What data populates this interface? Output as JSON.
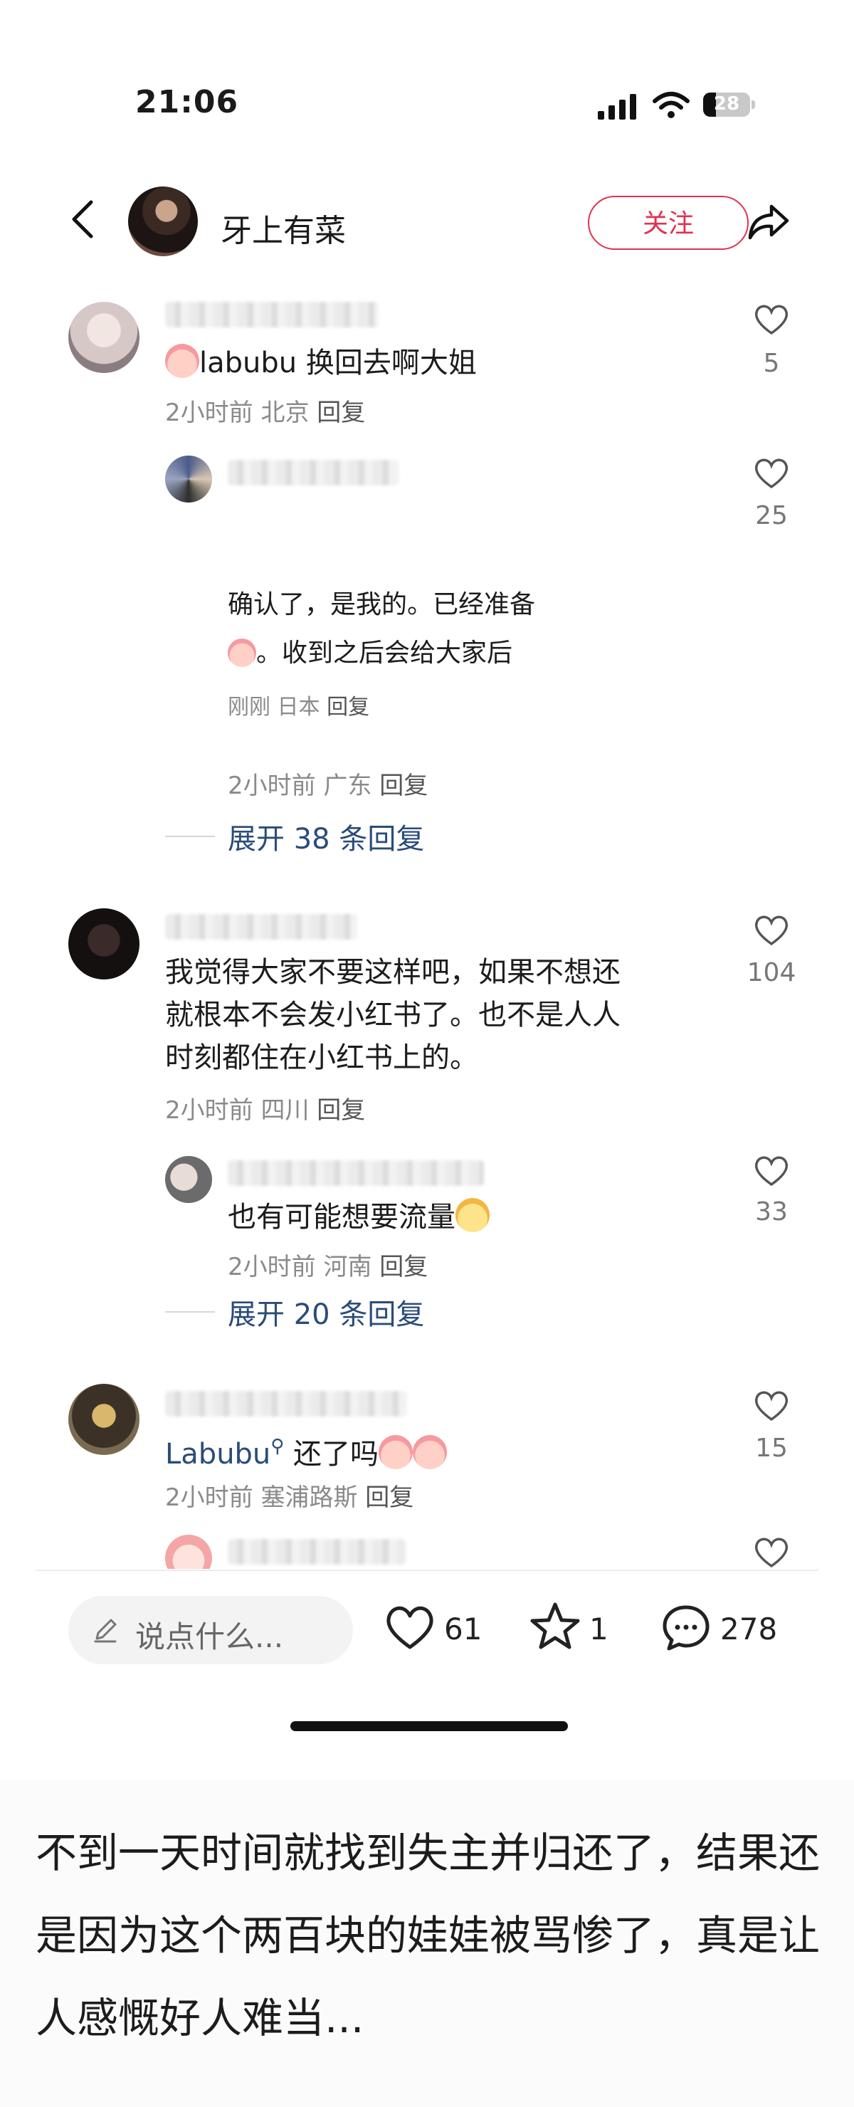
{
  "status_bar": {
    "time": "21:06",
    "battery": "28"
  },
  "header": {
    "author_name": "牙上有菜",
    "follow_label": "关注"
  },
  "comments": [
    {
      "text": "labubu 换回去啊大姐",
      "meta": {
        "time": "2小时前",
        "location": "北京",
        "reply": "回复"
      },
      "likes": "5",
      "replies": [
        {
          "likes": "25",
          "quoted_lines": [
            "确认了，是我的。已经准备",
            "。收到之后会给大家后"
          ],
          "quoted_meta": {
            "time": "刚刚",
            "location": "日本",
            "reply": "回复"
          },
          "meta": {
            "time": "2小时前",
            "location": "广东",
            "reply": "回复"
          }
        }
      ],
      "expand": "展开 38 条回复"
    },
    {
      "text_lines": [
        "我觉得大家不要这样吧，如果不想还",
        "就根本不会发小红书了。也不是人人",
        "时刻都住在小红书上的。"
      ],
      "meta": {
        "time": "2小时前",
        "location": "四川",
        "reply": "回复"
      },
      "likes": "104",
      "replies": [
        {
          "text": "也有可能想要流量",
          "meta": {
            "time": "2小时前",
            "location": "河南",
            "reply": "回复"
          },
          "likes": "33"
        }
      ],
      "expand": "展开 20 条回复"
    },
    {
      "mention": "Labubu",
      "text": "还了吗",
      "meta": {
        "time": "2小时前",
        "location": "塞浦路斯",
        "reply": "回复"
      },
      "likes": "15"
    }
  ],
  "bottom_bar": {
    "input_placeholder": "说点什么...",
    "like_count": "61",
    "star_count": "1",
    "comment_count": "278"
  },
  "caption": "不到一天时间就找到失主并归还了，结果还是因为这个两百块的娃娃被骂惨了，真是让人感慨好人难当..."
}
